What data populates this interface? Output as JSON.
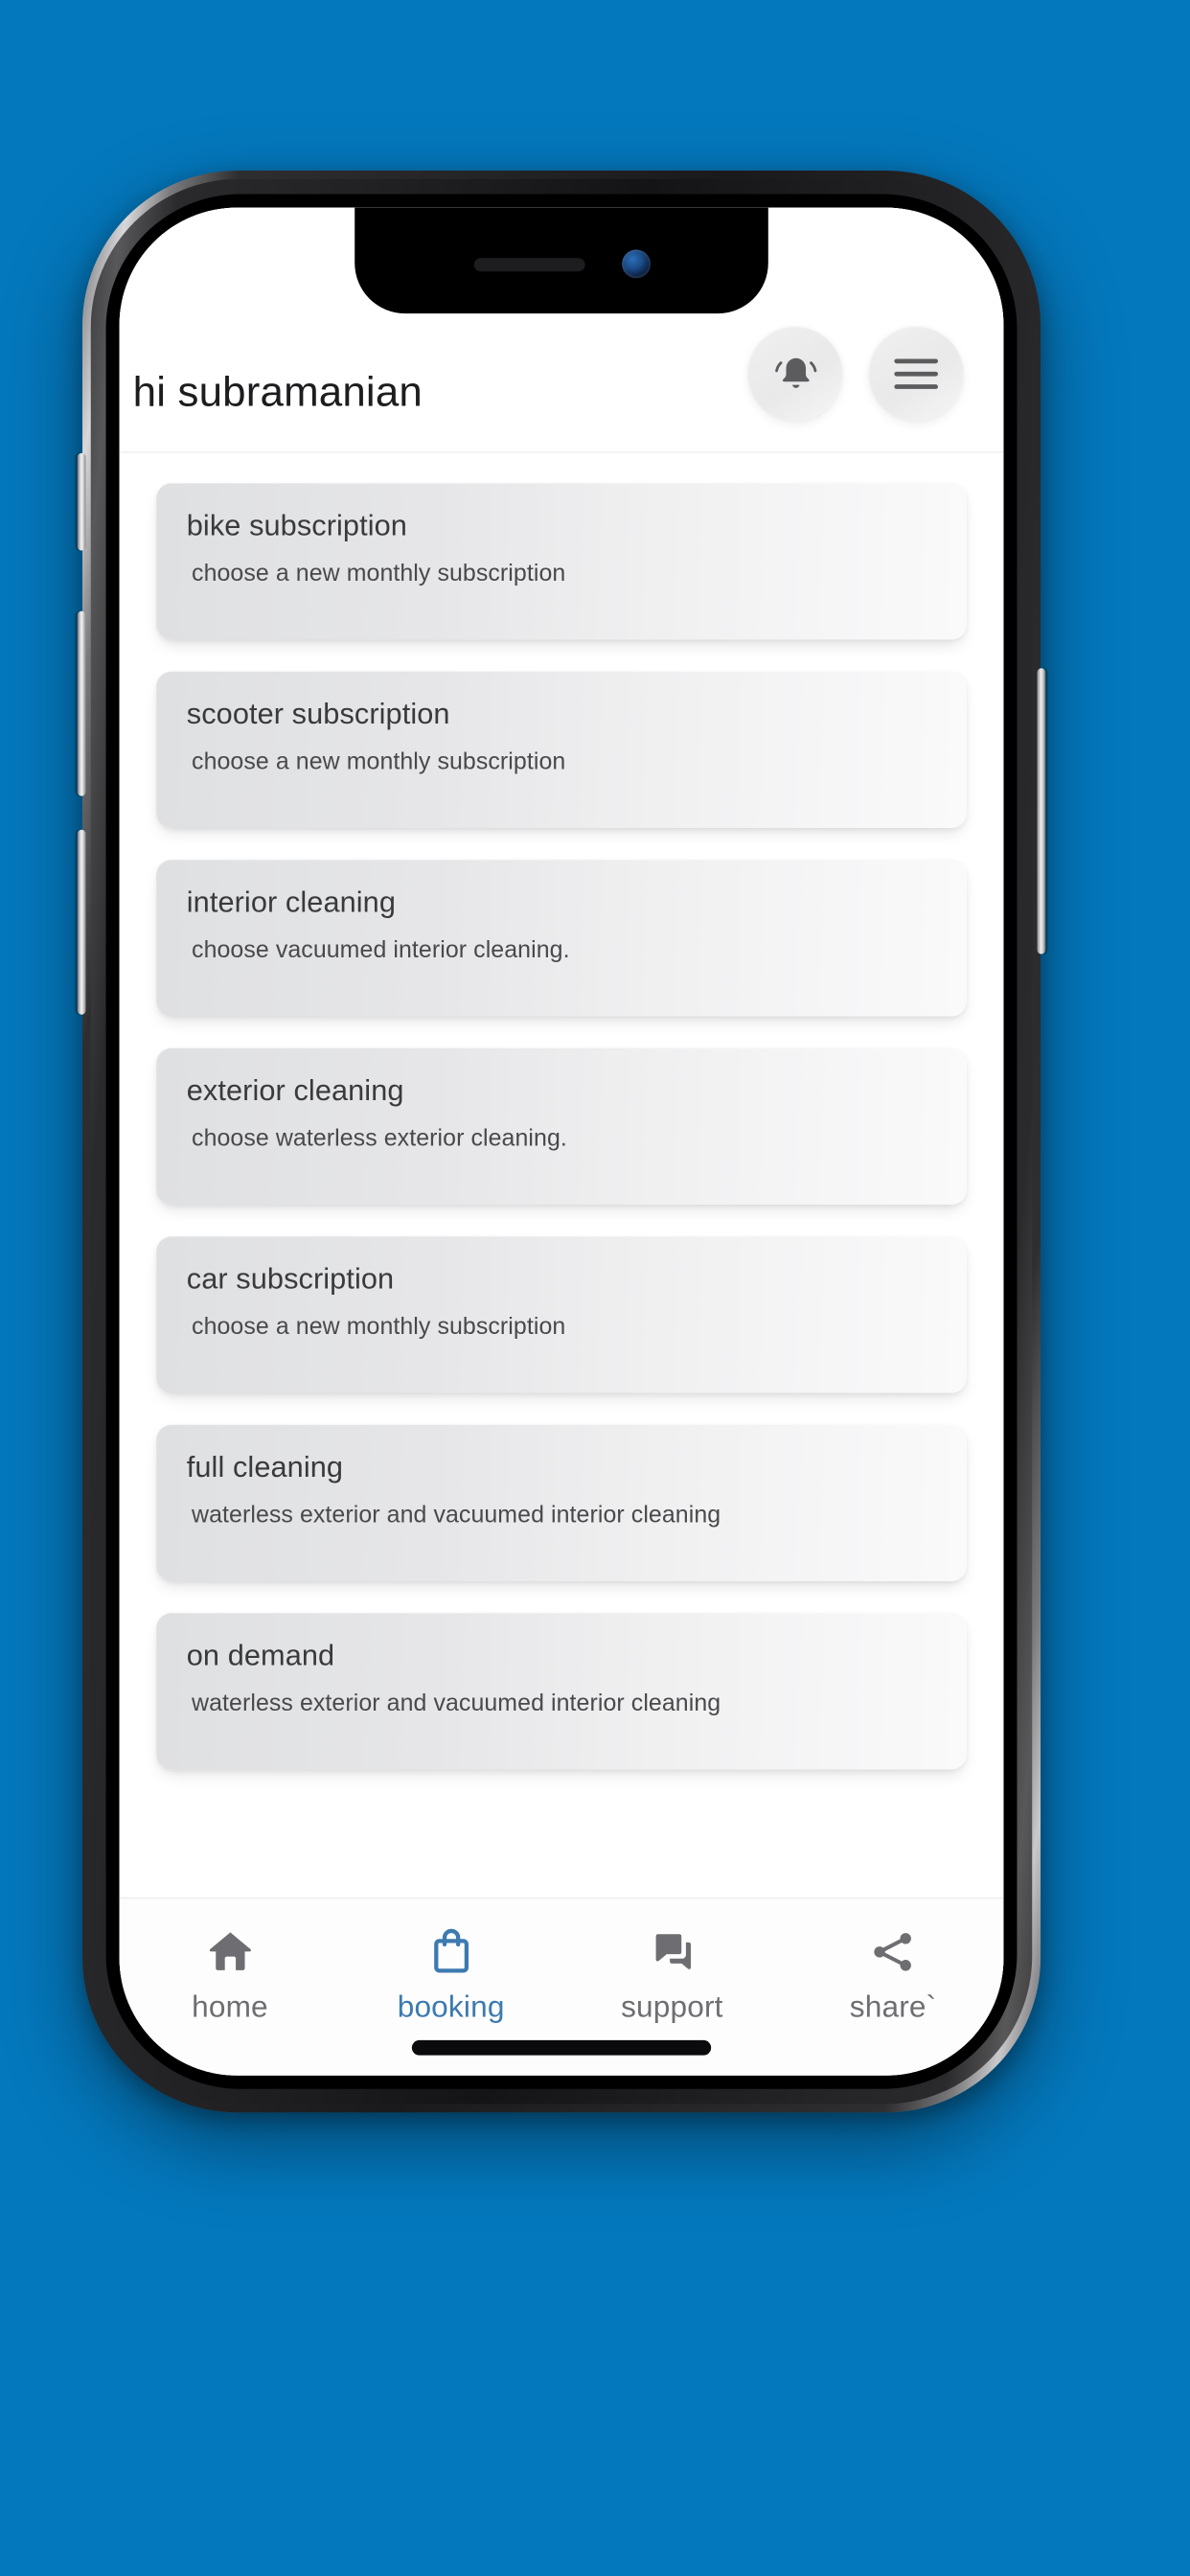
{
  "background_color": "#0478bd",
  "device": {
    "frame_color": "#1a1a1c",
    "notch": {
      "speaker_name": "earpiece-speaker",
      "camera_name": "front-camera"
    },
    "buttons": [
      {
        "name": "silence-switch"
      },
      {
        "name": "volume-up-button"
      },
      {
        "name": "volume-down-button"
      },
      {
        "name": "power-button"
      }
    ],
    "home_indicator_name": "home-indicator"
  },
  "header": {
    "greeting": "hi subramanian",
    "notification_icon": "bell-icon",
    "menu_icon": "hamburger-menu-icon"
  },
  "cards": [
    {
      "title": "bike subscription",
      "subtitle": "choose a new monthly subscription"
    },
    {
      "title": "scooter subscription",
      "subtitle": "choose a new monthly subscription"
    },
    {
      "title": "interior cleaning",
      "subtitle": "choose vacuumed interior cleaning."
    },
    {
      "title": "exterior cleaning",
      "subtitle": "choose waterless exterior cleaning."
    },
    {
      "title": "car subscription",
      "subtitle": "choose a new monthly subscription"
    },
    {
      "title": "full cleaning",
      "subtitle": "waterless exterior and vacuumed interior cleaning"
    },
    {
      "title": "on demand",
      "subtitle": "waterless exterior and vacuumed interior cleaning"
    }
  ],
  "bottom_nav": {
    "active_color": "#3d7ab0",
    "inactive_color": "#6e6e72",
    "items": [
      {
        "label": "home",
        "icon": "home-icon",
        "active": false
      },
      {
        "label": "booking",
        "icon": "shopping-bag-icon",
        "active": true
      },
      {
        "label": "support",
        "icon": "chat-bubbles-icon",
        "active": false
      },
      {
        "label": "share`",
        "icon": "share-icon",
        "active": false
      }
    ]
  }
}
